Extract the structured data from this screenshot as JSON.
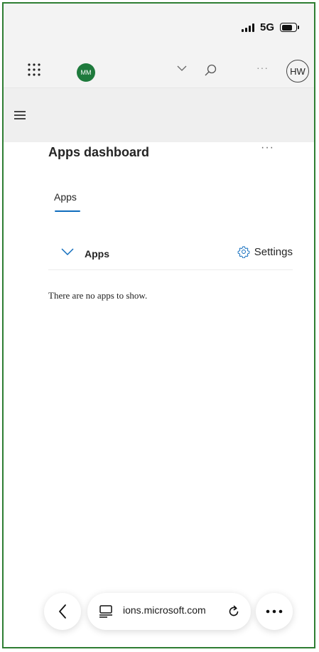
{
  "status_bar": {
    "network": "5G"
  },
  "header": {
    "user_avatar_initials": "MM",
    "profile_initials": "HW",
    "more_label": "···"
  },
  "page": {
    "title": "Apps dashboard",
    "more_label": "···",
    "tabs": [
      {
        "label": "Apps",
        "selected": true
      }
    ],
    "section": {
      "title": "Apps",
      "settings_label": "Settings"
    },
    "empty_message": "There are no apps to show."
  },
  "browser": {
    "url": "ions.microsoft.com"
  },
  "colors": {
    "accent": "#0f6cbd",
    "avatar_bg": "#1e7a3c",
    "frame_border": "#2e7d32"
  }
}
